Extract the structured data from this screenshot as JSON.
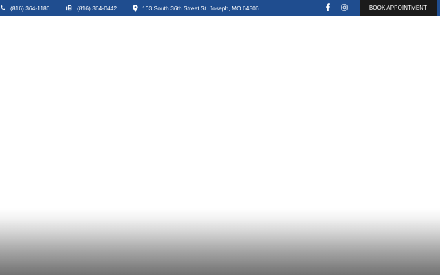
{
  "topbar": {
    "phone": {
      "icon": "phone-icon",
      "text": "(816) 364-1186"
    },
    "fax": {
      "icon": "fax-icon",
      "text": "(816) 364-0442"
    },
    "address": {
      "icon": "map-pin-icon",
      "text": "103 South 36th Street St. Joseph, MO 64506"
    },
    "social": [
      {
        "icon": "facebook-icon"
      },
      {
        "icon": "instagram-icon"
      }
    ],
    "book_button": "BOOK APPOINTMENT",
    "colors": {
      "bar": "#1f4d8f",
      "button": "#1b1b1b",
      "text": "#ffffff"
    }
  }
}
